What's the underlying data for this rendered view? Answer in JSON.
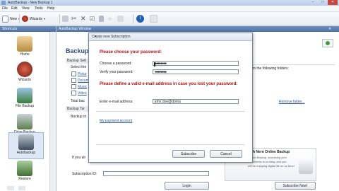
{
  "window": {
    "title": "AutoBackup - New Backup 1",
    "minimize": "–",
    "maximize": "□",
    "close": "✕"
  },
  "menu": [
    "File",
    "Edit",
    "View",
    "Tools",
    "Help"
  ],
  "toolbar": {
    "new_label": "New",
    "wizards_label": "Wizards"
  },
  "shortcuts": {
    "title": "Shortcuts",
    "items": [
      "Home",
      "Wizards",
      "File Backup",
      "Drive Backup",
      "Autobackup",
      "Restore"
    ]
  },
  "main": {
    "header": "AutoBackup Window",
    "title": "Backup",
    "section1": "Backup Sett",
    "select_text": "Select the",
    "items": [
      "Pictur",
      "Docum",
      "Music",
      "Video"
    ],
    "total_text": "Total bac",
    "section2": "Backup Tar",
    "backup_text": "Backup to",
    "folders_text": "from the following folders:",
    "remove_folder": "Remove folder...",
    "if_you_text": "If you alr",
    "subscription_id_label": "Subscription ID:",
    "login_label": "Login",
    "promo_title": "with Nero Online Backup",
    "promo_lines": [
      "Online Backup, accessing your",
      "documents is so easy, and you",
      "will be enjoying digital life on no time!"
    ],
    "subscribe_now": "Subscribe Now!"
  },
  "dialog": {
    "title": "Create new Subscription",
    "heading1": "Please choose your password:",
    "choose_password_label": "Choose a password:",
    "verify_password_label": "Verify your password:",
    "password_value": "●●●●●●●●",
    "verify_value": "●●●●●●●●",
    "heading2": "Please define a valid e-mail address in case you lost your password:",
    "email_label": "Enter e-mail address:",
    "email_value": "john.doe@doma",
    "account_link": "My payment account",
    "subscribe_label": "Subscribe",
    "cancel_label": "Cancel",
    "close": "✕"
  },
  "colors": {
    "accent": "#4e72a4",
    "heading_red": "#b01010",
    "link": "#2a55a8"
  }
}
